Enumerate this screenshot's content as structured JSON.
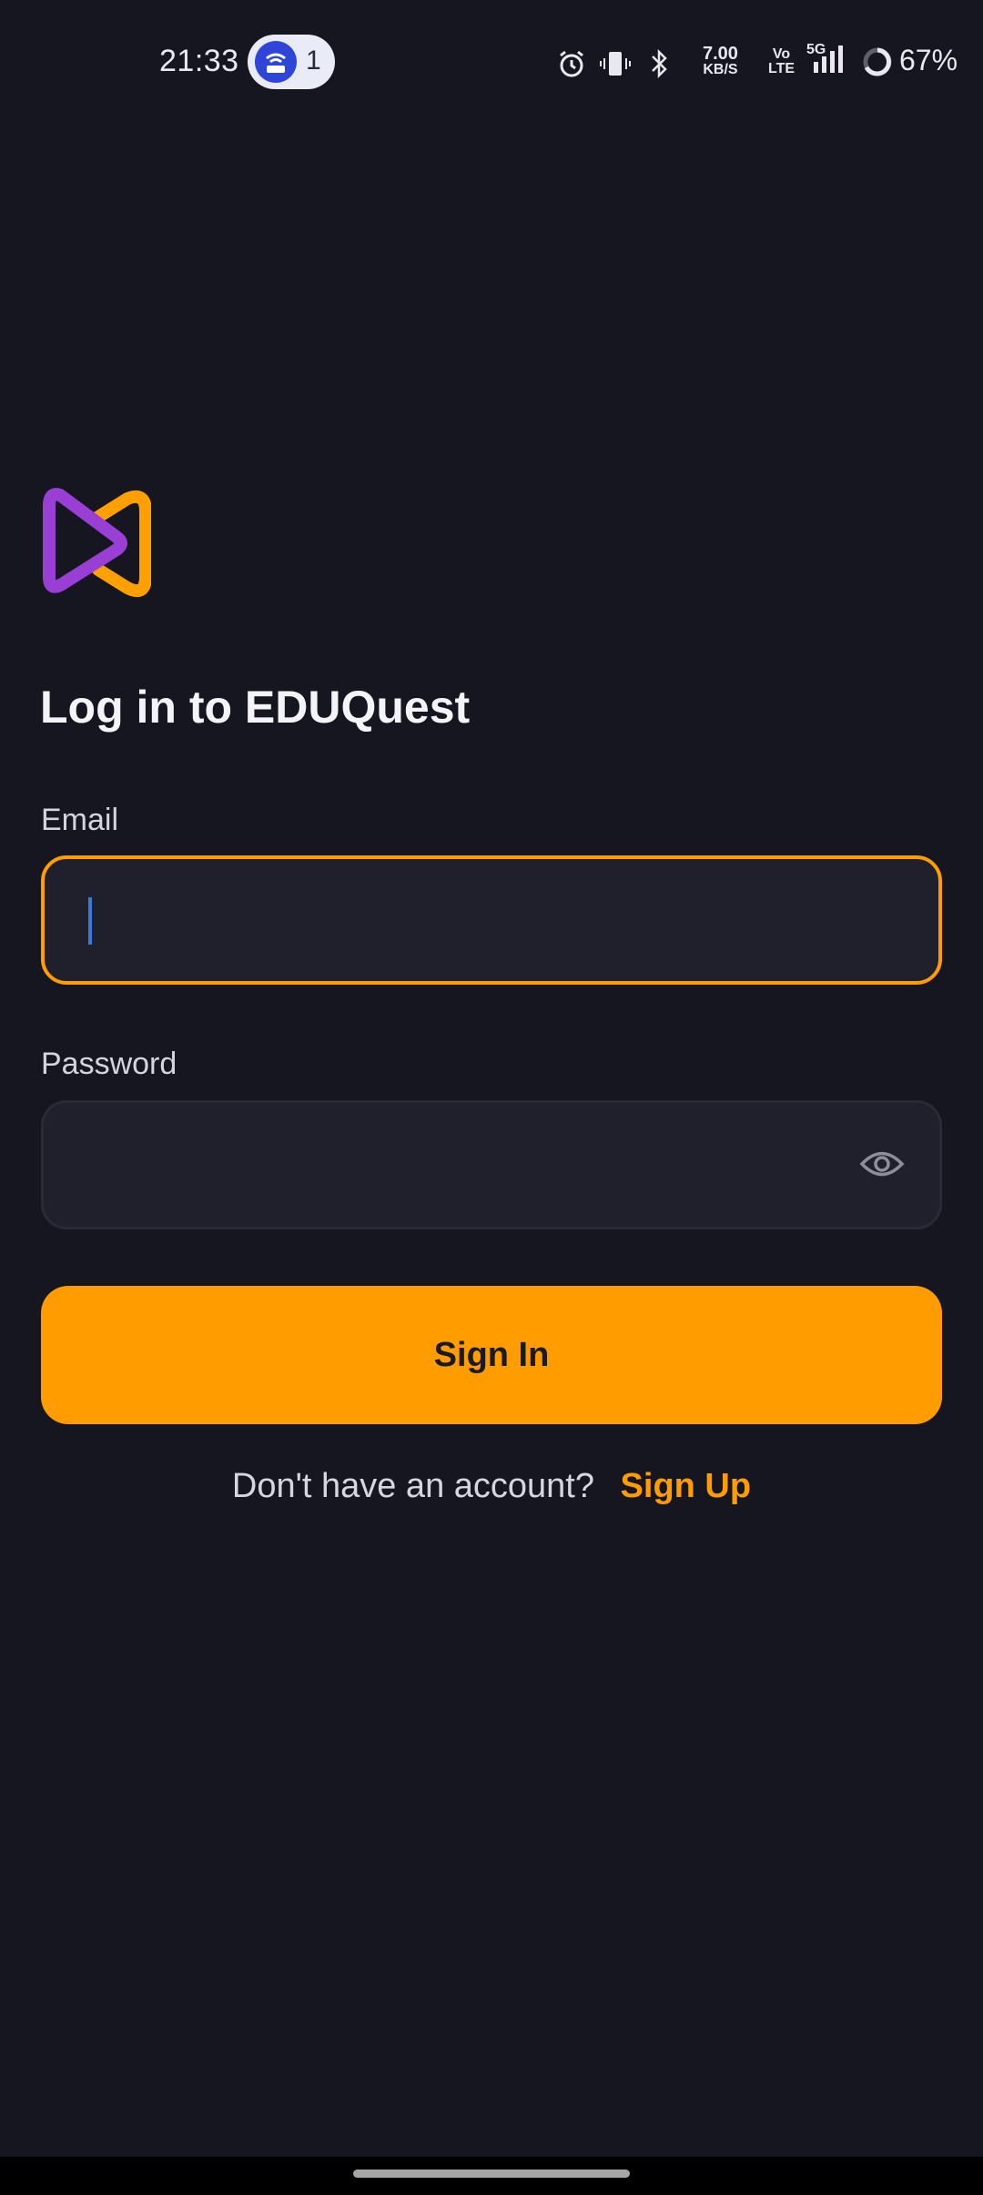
{
  "status_bar": {
    "time": "21:33",
    "hotspot_count": "1",
    "speed_value": "7.00",
    "speed_unit": "KB/S",
    "network_top": "Vo",
    "network_bottom": "LTE",
    "signal_type": "5G",
    "battery": "67%"
  },
  "login": {
    "title": "Log in to EDUQuest",
    "email_label": "Email",
    "email_value": "",
    "password_label": "Password",
    "password_value": "",
    "sign_in_label": "Sign In",
    "signup_prompt": "Don't have an account?",
    "signup_link": "Sign Up"
  },
  "colors": {
    "background": "#161620",
    "accent": "#ff9d00",
    "field_background": "#20202d",
    "logo_purple": "#9a3fd6",
    "logo_orange": "#ffa000"
  },
  "icons": [
    "app-logo-icon",
    "eye-icon",
    "alarm-icon",
    "vibrate-icon",
    "bluetooth-icon",
    "signal-icon",
    "battery-icon",
    "hotspot-icon"
  ]
}
